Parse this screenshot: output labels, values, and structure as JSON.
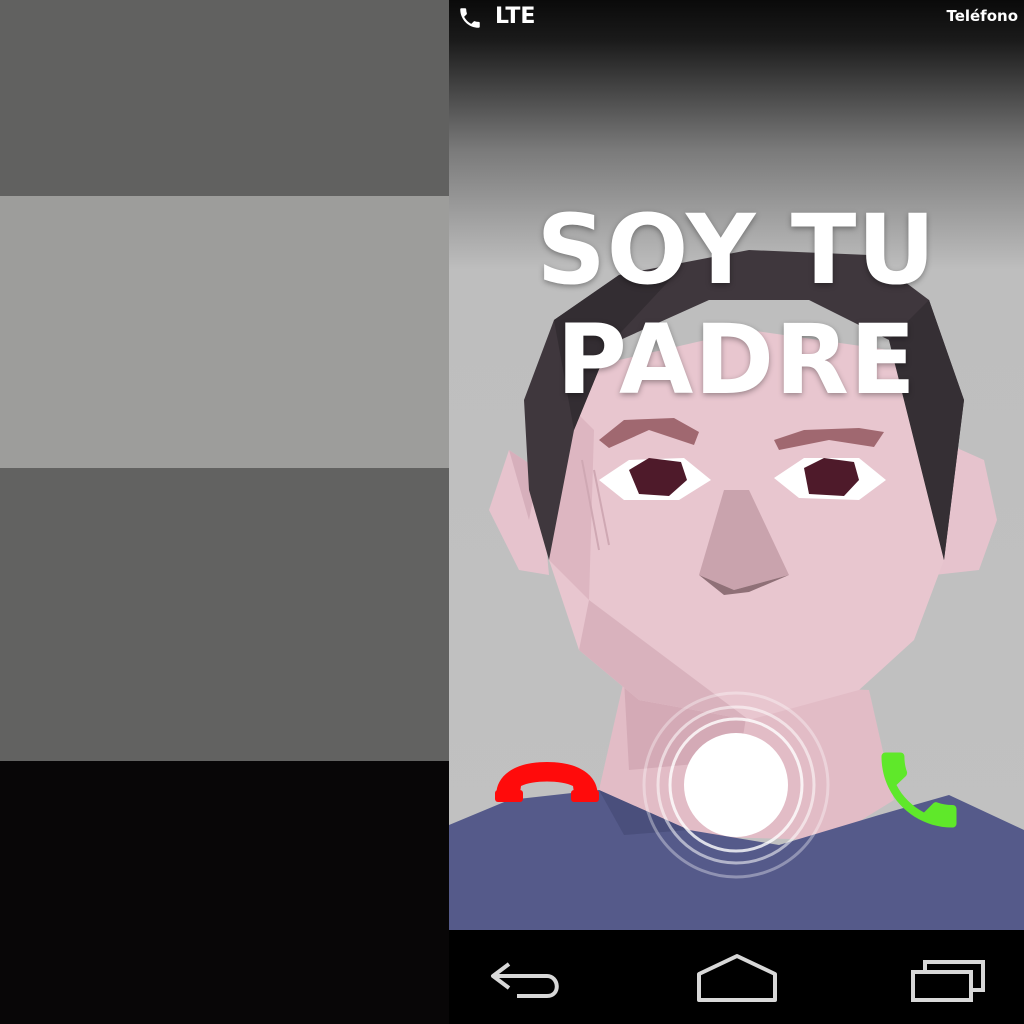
{
  "status_bar": {
    "network": "LTE",
    "app_name": "Teléfono",
    "icon": "phone-icon"
  },
  "call": {
    "caller_line1": "SOY TU",
    "caller_line2": "PADRE",
    "decline_icon": "hang-up-icon",
    "accept_icon": "phone-answer-icon",
    "handle_icon": "call-slider-handle"
  },
  "nav": {
    "back_icon": "back-icon",
    "home_icon": "home-icon",
    "recents_icon": "recents-icon"
  },
  "colors": {
    "decline": "#ff0b0b",
    "accept": "#5fe82a",
    "shirt": "#555a8a",
    "skin": "#e8c6cf",
    "hair": "#3f373d"
  }
}
